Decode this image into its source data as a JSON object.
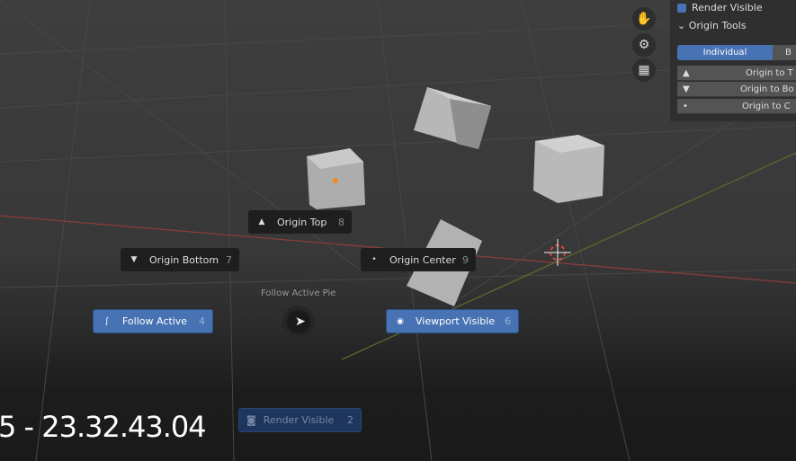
{
  "pie_menu": {
    "title": "Follow Active Pie",
    "items": [
      {
        "label": "Origin Top",
        "key": "8",
        "icon": "triangle-up-icon"
      },
      {
        "label": "Origin Bottom",
        "key": "7",
        "icon": "triangle-down-icon"
      },
      {
        "label": "Origin Center",
        "key": "9",
        "icon": "dot-icon"
      },
      {
        "label": "Follow Active",
        "key": "4",
        "icon": "curve-icon"
      },
      {
        "label": "Viewport Visible",
        "key": "6",
        "icon": "eye-icon"
      },
      {
        "label": "Render Visible",
        "key": "2",
        "icon": "camera-icon"
      }
    ]
  },
  "timestamp": "5 - 23.32.43.04",
  "sidebar": {
    "top_checkbox_label": "Render Visible",
    "section_title": "Origin Tools",
    "segments": [
      "Individual",
      "B"
    ],
    "rows": [
      {
        "label": "Origin to T",
        "icon": "triangle-up-icon"
      },
      {
        "label": "Origin to Bo",
        "icon": "triangle-down-icon"
      },
      {
        "label": "Origin to C",
        "icon": "dot-icon"
      }
    ]
  },
  "nav_icons": [
    "hand-icon",
    "camera-icon",
    "grid-icon"
  ],
  "colors": {
    "accent": "#4772b3",
    "x_axis": "#a04545",
    "y_axis": "#6b7d3a"
  }
}
